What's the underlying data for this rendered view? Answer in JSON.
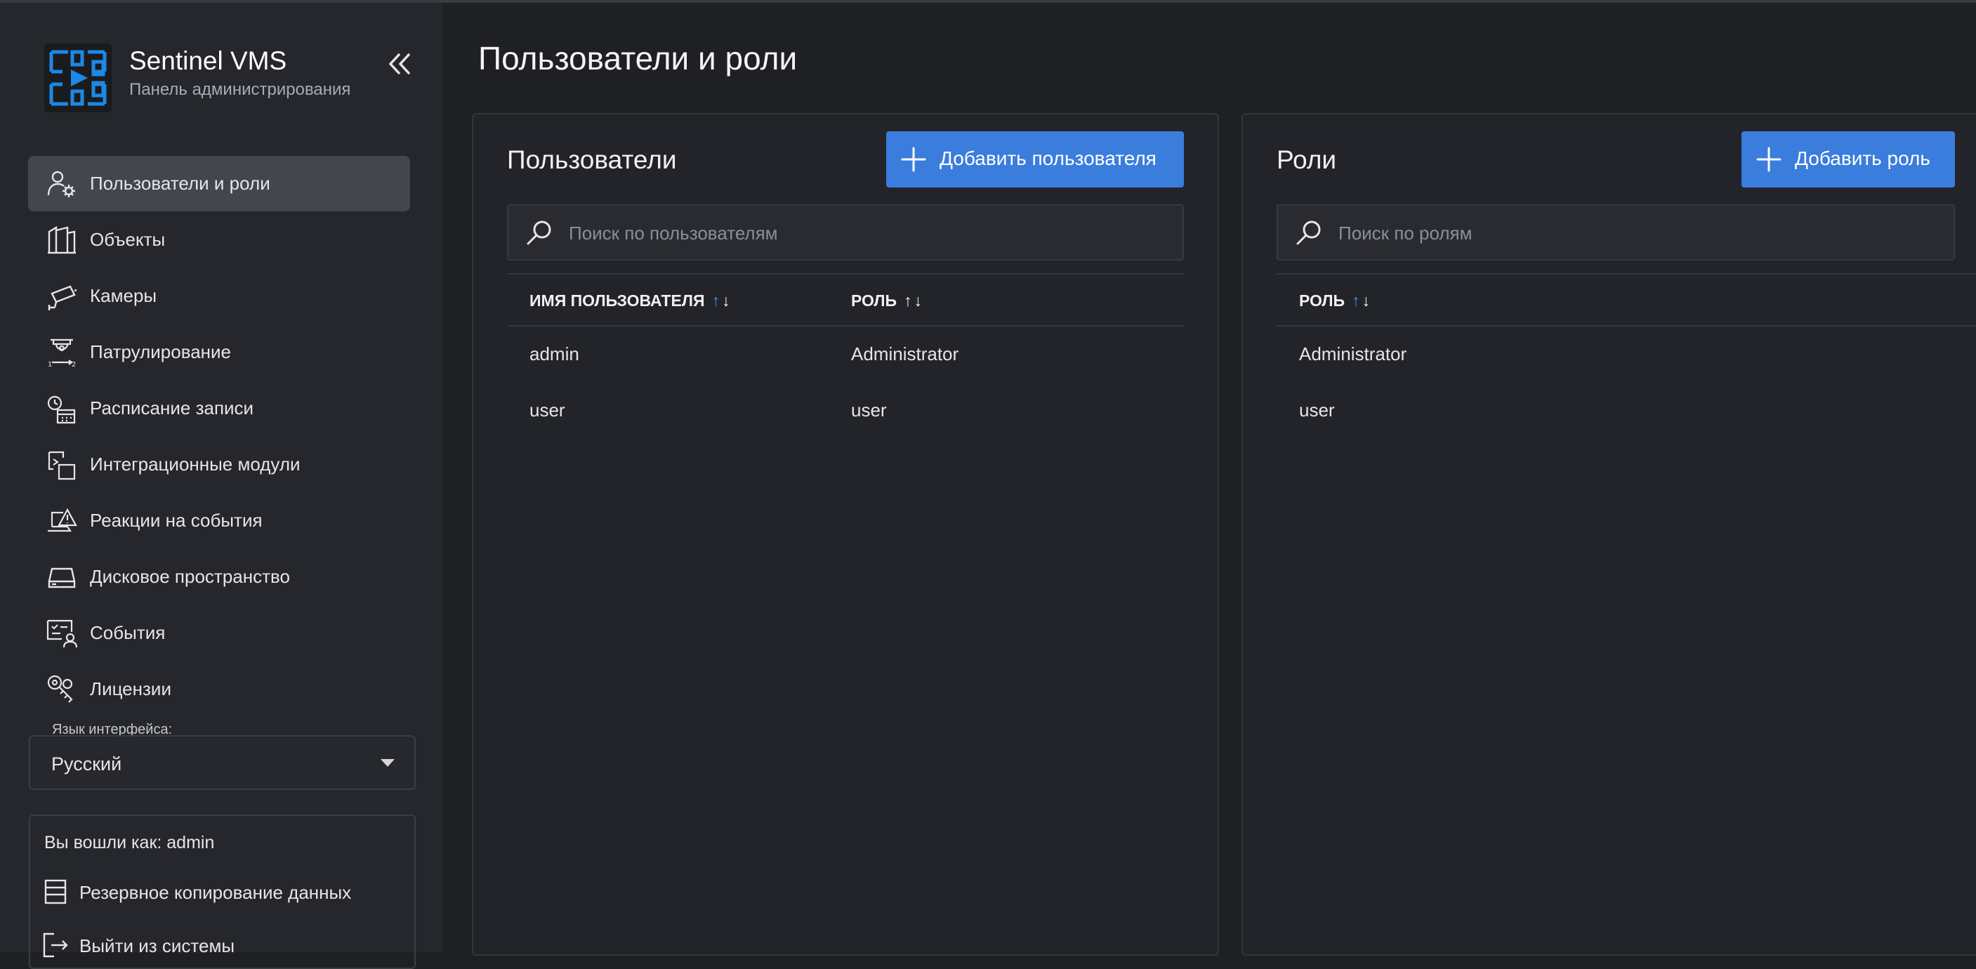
{
  "app": {
    "name": "Sentinel VMS",
    "subtitle": "Панель администрирования"
  },
  "sidebar": {
    "items": [
      {
        "label": "Пользователи и роли",
        "icon": "users-gear-icon",
        "active": true
      },
      {
        "label": "Объекты",
        "icon": "buildings-icon",
        "active": false
      },
      {
        "label": "Камеры",
        "icon": "camera-icon",
        "active": false
      },
      {
        "label": "Патрулирование",
        "icon": "patrol-icon",
        "active": false
      },
      {
        "label": "Расписание записи",
        "icon": "schedule-icon",
        "active": false
      },
      {
        "label": "Интеграционные модули",
        "icon": "integration-icon",
        "active": false
      },
      {
        "label": "Реакции на события",
        "icon": "event-reaction-icon",
        "active": false
      },
      {
        "label": "Дисковое пространство",
        "icon": "disk-icon",
        "active": false
      },
      {
        "label": "События",
        "icon": "events-icon",
        "active": false
      },
      {
        "label": "Лицензии",
        "icon": "keys-icon",
        "active": false
      }
    ],
    "language": {
      "label": "Язык интерфейса:",
      "value": "Русский"
    },
    "account": {
      "logged_in_as": "Вы вошли как: admin",
      "backup": "Резервное копирование данных",
      "logout": "Выйти из системы"
    }
  },
  "page": {
    "title": "Пользователи и роли"
  },
  "users_panel": {
    "title": "Пользователи",
    "add_button": "Добавить пользователя",
    "search_placeholder": "Поиск по пользователям",
    "columns": [
      "ИМЯ ПОЛЬЗОВАТЕЛЯ",
      "РОЛЬ"
    ],
    "rows": [
      {
        "username": "admin",
        "role": "Administrator"
      },
      {
        "username": "user",
        "role": "user"
      }
    ]
  },
  "roles_panel": {
    "title": "Роли",
    "add_button": "Добавить роль",
    "search_placeholder": "Поиск по ролям",
    "columns": [
      "РОЛЬ"
    ],
    "rows": [
      {
        "role": "Administrator"
      },
      {
        "role": "user"
      }
    ]
  },
  "colors": {
    "accent": "#3b7ddd",
    "sort_active": "#4a8df0",
    "background": "#1f2024",
    "sidebar": "#26272c",
    "logo": "#1e88e5"
  }
}
